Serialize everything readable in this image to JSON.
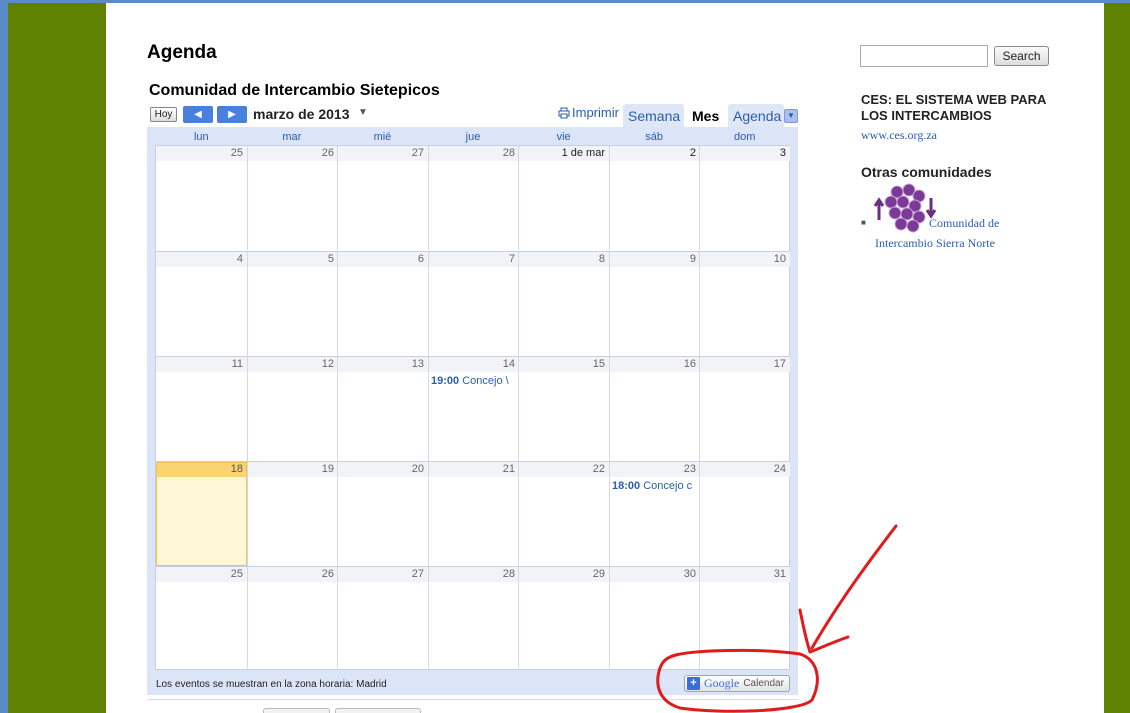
{
  "page": {
    "title": "Agenda"
  },
  "calendar": {
    "title": "Comunidad de Intercambio Sietepicos",
    "toolbar": {
      "today_label": "Hoy",
      "prev_icon": "◀",
      "next_icon": "▶",
      "month_label": "marzo de 2013",
      "month_caret": "▼",
      "print_label": "Imprimir",
      "tab_week": "Semana",
      "tab_month": "Mes",
      "tab_agenda": "Agenda",
      "agenda_dropdown": "▼"
    },
    "day_headers": [
      "lun",
      "mar",
      "mié",
      "jue",
      "vie",
      "sáb",
      "dom"
    ],
    "weeks": [
      {
        "days": [
          "25",
          "26",
          "27",
          "28",
          "1 de mar",
          "2",
          "3"
        ]
      },
      {
        "days": [
          "4",
          "5",
          "6",
          "7",
          "8",
          "9",
          "10"
        ]
      },
      {
        "days": [
          "11",
          "12",
          "13",
          "14",
          "15",
          "16",
          "17"
        ]
      },
      {
        "days": [
          "18",
          "19",
          "20",
          "21",
          "22",
          "23",
          "24"
        ]
      },
      {
        "days": [
          "25",
          "26",
          "27",
          "28",
          "29",
          "30",
          "31"
        ]
      }
    ],
    "events": {
      "mar14": {
        "time": "19:00",
        "title": "Concejo \\"
      },
      "mar23": {
        "time": "18:00",
        "title": "Concejo c"
      }
    },
    "timezone_note": "Los eventos se muestran en la zona horaria: Madrid",
    "gcal_button": {
      "plus": "+",
      "brand": "Google",
      "label": "Calendar"
    }
  },
  "sidebar": {
    "search_placeholder": "",
    "search_button": "Search",
    "ces_title": "CES: EL SISTEMA WEB PARA LOS INTERCAMBIOS",
    "ces_link": "www.ces.org.za",
    "other_title": "Otras comunidades",
    "other_link_line1": "Comunidad de",
    "other_link_line2": "Intercambio Sierra Norte",
    "bullet": "■"
  },
  "colors": {
    "frame_green": "#5f8300",
    "accent_blue": "#2a5db0",
    "today_yellow": "#f9d470",
    "annotation_red": "#e01b1b"
  }
}
